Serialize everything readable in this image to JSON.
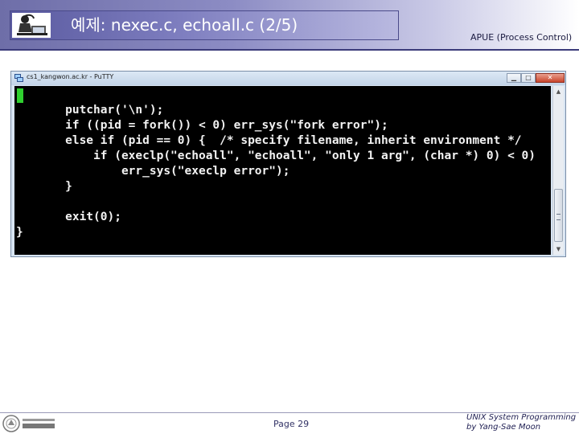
{
  "slide": {
    "title": "예제: nexec.c, echoall.c (2/5)",
    "subtitle": "APUE (Process Control)"
  },
  "window": {
    "title": "cs1_kangwon.ac.kr - PuTTY",
    "controls": {
      "minimize": "▁",
      "maximize": "□",
      "close": "✕"
    }
  },
  "terminal": {
    "code": "       putchar('\\n');\n       if ((pid = fork()) < 0) err_sys(\"fork error\");\n       else if (pid == 0) {  /* specify filename, inherit environment */\n           if (execlp(\"echoall\", \"echoall\", \"only 1 arg\", (char *) 0) < 0)\n               err_sys(\"execlp error\");\n       }\n\n       exit(0);\n}",
    "scroll_arrows": {
      "up": "▲",
      "down": "▼"
    }
  },
  "footer": {
    "page": "Page 29",
    "credit_line1": "UNIX System Programming",
    "credit_line2": "by Yang-Sae Moon"
  },
  "colors": {
    "header_dark": "#3b3b7a",
    "terminal_bg": "#000000",
    "terminal_text": "#f2f2f2",
    "cursor": "#2fd02f",
    "close_button": "#c9452c"
  },
  "icons": {
    "title_icon": "person-at-computer-icon",
    "window_icon": "putty-icon",
    "footer_logo": "university-logo"
  }
}
